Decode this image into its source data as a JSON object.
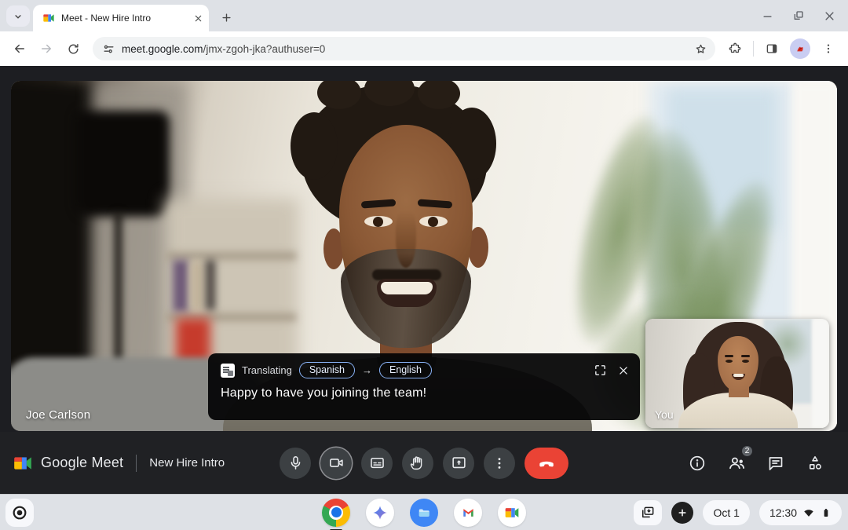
{
  "browser": {
    "tab_title": "Meet - New Hire Intro",
    "url_domain": "meet.google.com",
    "url_path": "/jmx-zgoh-jka?authuser=0"
  },
  "meet": {
    "brand": "Google Meet",
    "meeting_name": "New Hire Intro",
    "speaker_name": "Joe Carlson",
    "self_view_label": "You",
    "participants_count": "2",
    "caption": {
      "status_label": "Translating",
      "source_language": "Spanish",
      "arrow": "→",
      "target_language": "English",
      "text": "Happy to have you joining the team!"
    },
    "controls": [
      "microphone",
      "camera",
      "captions",
      "raise-hand",
      "present",
      "more-options",
      "end-call"
    ],
    "panel_icons": [
      "meeting-details",
      "people",
      "chat",
      "activities"
    ]
  },
  "shelf": {
    "date": "Oct 1",
    "time": "12:30",
    "apps": [
      "chrome",
      "gemini",
      "files",
      "gmail",
      "meet"
    ]
  },
  "colors": {
    "accent_blue": "#8ab4f8",
    "end_call_red": "#ea4335",
    "dark_surface": "#202124",
    "control_gray": "#3c4043",
    "shelf_bg": "#dee1e6"
  }
}
